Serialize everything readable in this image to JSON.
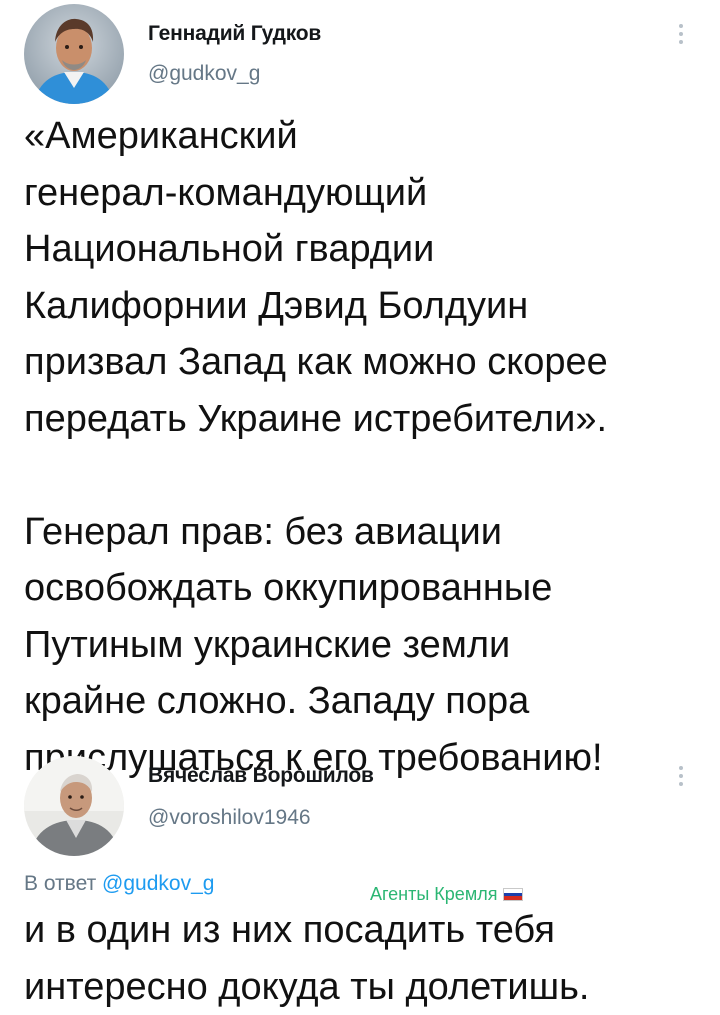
{
  "tweet1": {
    "author_name": "Геннадий Гудков",
    "author_handle": "@gudkov_g",
    "text_lines": [
      "«Американский",
      "генерал-командующий",
      "Национальной гвардии",
      "Калифорнии Дэвид Болдуин",
      "призвал Запад как можно скорее",
      "передать Украине истребители».",
      "",
      "Генерал прав: без авиации",
      "освобождать оккупированные",
      "Путиным украинские земли",
      "крайне сложно. Западу пора",
      "прислушаться к его требованию!"
    ],
    "avatar_icon": "person-photo-icon",
    "more_icon": "more-vertical-icon"
  },
  "tweet2": {
    "author_name": "Вячеслав Ворошилов",
    "author_handle": "@voroshilov1946",
    "reply_prefix": "В ответ",
    "reply_handle": "@gudkov_g",
    "overlay_label": "Агенты Кремля",
    "flag_icon": "russian-flag-icon",
    "text_lines": [
      "и в один из них посадить тебя",
      "интересно докуда ты долетишь."
    ],
    "avatar_icon": "person-photo-icon",
    "more_icon": "more-vertical-icon"
  },
  "colors": {
    "text": "#111111",
    "secondary": "#657786",
    "link": "#1d9bf0",
    "overlay_green": "#2bb673"
  }
}
